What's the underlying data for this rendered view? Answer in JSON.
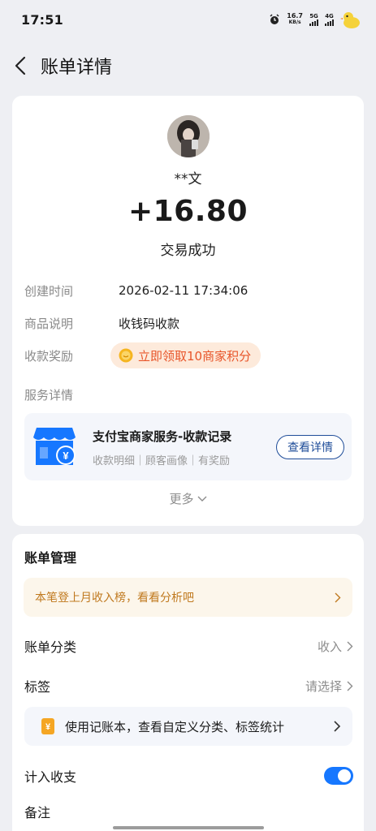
{
  "status_bar": {
    "time": "17:51",
    "net_speed_value": "16.7",
    "net_speed_unit": "KB/s",
    "signal_1": "5G",
    "signal_2": "4G",
    "icons": [
      "alarm-icon",
      "signal-icon",
      "signal-icon",
      "duck-avatar-icon"
    ]
  },
  "nav": {
    "back_icon": "chevron-left-icon",
    "title": "账单详情"
  },
  "transaction": {
    "payer_name": "**文",
    "amount": "+16.80",
    "status": "交易成功"
  },
  "details": {
    "created_label": "创建时间",
    "created_value": "2026-02-11 17:34:06",
    "product_label": "商品说明",
    "product_value": "收钱码收款",
    "reward_label": "收款奖励",
    "reward_button": "立即领取10商家积分",
    "service_label": "服务详情"
  },
  "service": {
    "title": "支付宝商家服务-收款记录",
    "subtitle": "收款明细｜顾客画像｜有奖励",
    "button": "查看详情",
    "more": "更多"
  },
  "manage": {
    "title": "账单管理",
    "insight": "本笔登上月收入榜，看看分析吧",
    "category_label": "账单分类",
    "category_value": "收入",
    "tag_label": "标签",
    "tag_value": "请选择",
    "ledger_text": "使用记账本，查看自定义分类、标签统计",
    "count_label": "计入收支",
    "count_enabled": true,
    "note_label": "备注"
  },
  "colors": {
    "accent_blue": "#1677ff",
    "reward_orange": "#e8552a",
    "insight_text": "#c0791f",
    "button_blue": "#1f4d99"
  }
}
